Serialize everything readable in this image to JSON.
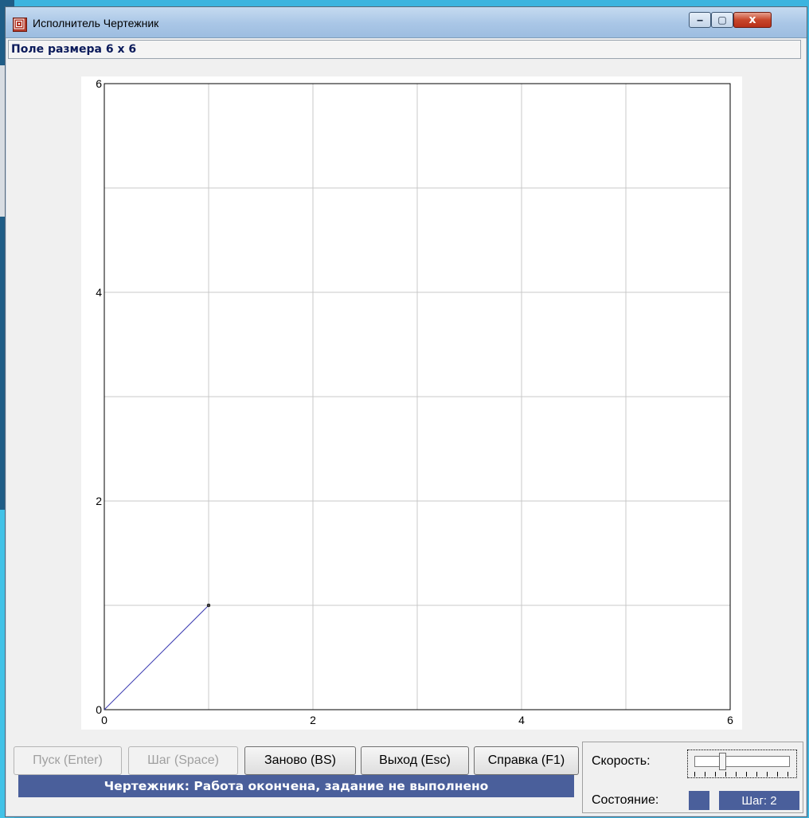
{
  "window": {
    "title": "Исполнитель Чертежник",
    "controls": {
      "minimize": "‒",
      "maximize": "▢",
      "close": "x"
    }
  },
  "field_label": "Поле размера 6 x 6",
  "chart_data": {
    "type": "line",
    "title": "",
    "xlabel": "",
    "ylabel": "",
    "xlim": [
      0,
      6
    ],
    "ylim": [
      0,
      6
    ],
    "x_tick_labels": [
      "0",
      "2",
      "4",
      "6"
    ],
    "y_tick_labels": [
      "0",
      "2",
      "4",
      "6"
    ],
    "grid_step": 1,
    "grid": true,
    "series": [
      {
        "x": [
          0,
          1
        ],
        "y": [
          0,
          1
        ],
        "color": "#3a3ab0"
      }
    ],
    "endpoint": {
      "x": 1,
      "y": 1
    }
  },
  "buttons": {
    "run": "Пуск (Enter)",
    "step": "Шаг (Space)",
    "reset": "Заново (BS)",
    "exit": "Выход (Esc)",
    "help": "Справка (F1)"
  },
  "speed_label": "Скорость:",
  "speed_level": 0.28,
  "state_label": "Состояние:",
  "step_counter": "Шаг: 2",
  "status_message": "Чертежник: Работа окончена, задание не выполнено",
  "colors": {
    "status_bg": "#4a5f9b",
    "line": "#3a3ab0",
    "grid": "#c8c8c8"
  }
}
